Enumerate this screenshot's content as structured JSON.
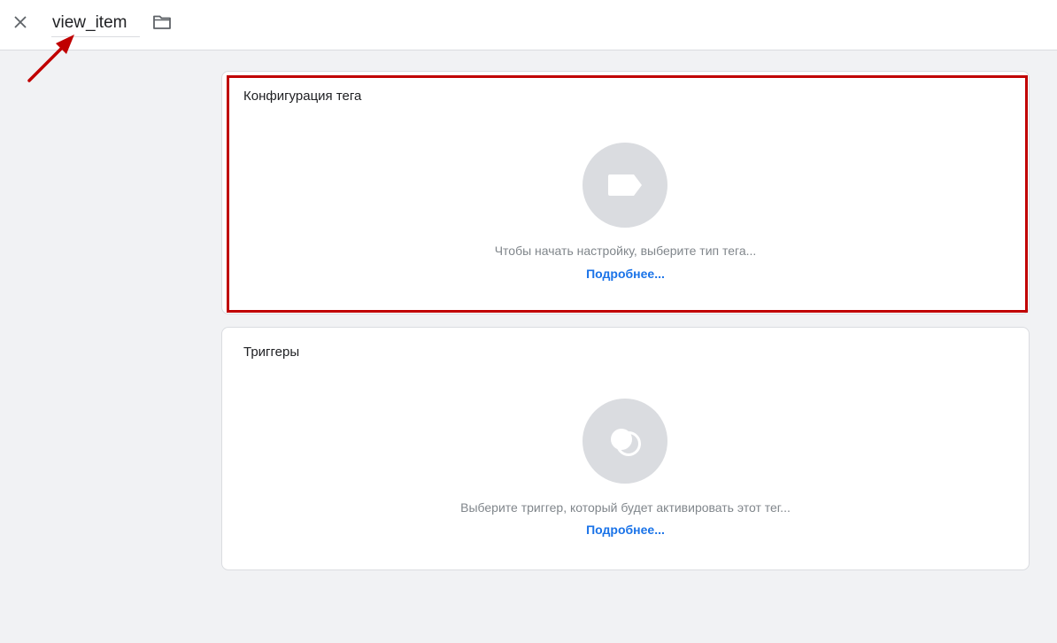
{
  "header": {
    "tag_name": "view_item",
    "close_icon": "close-icon",
    "folder_icon": "folder-icon"
  },
  "tag_config": {
    "title": "Конфигурация тега",
    "icon": "tag-icon",
    "hint": "Чтобы начать настройку, выберите тип тега...",
    "link": "Подробнее..."
  },
  "triggers": {
    "title": "Триггеры",
    "icon": "trigger-icon",
    "hint": "Выберите триггер, который будет активировать этот тег...",
    "link": "Подробнее..."
  },
  "colors": {
    "highlight": "#c00000",
    "annotation_arrow": "#c00000",
    "link": "#1a73e8",
    "placeholder": "#dadce0"
  }
}
